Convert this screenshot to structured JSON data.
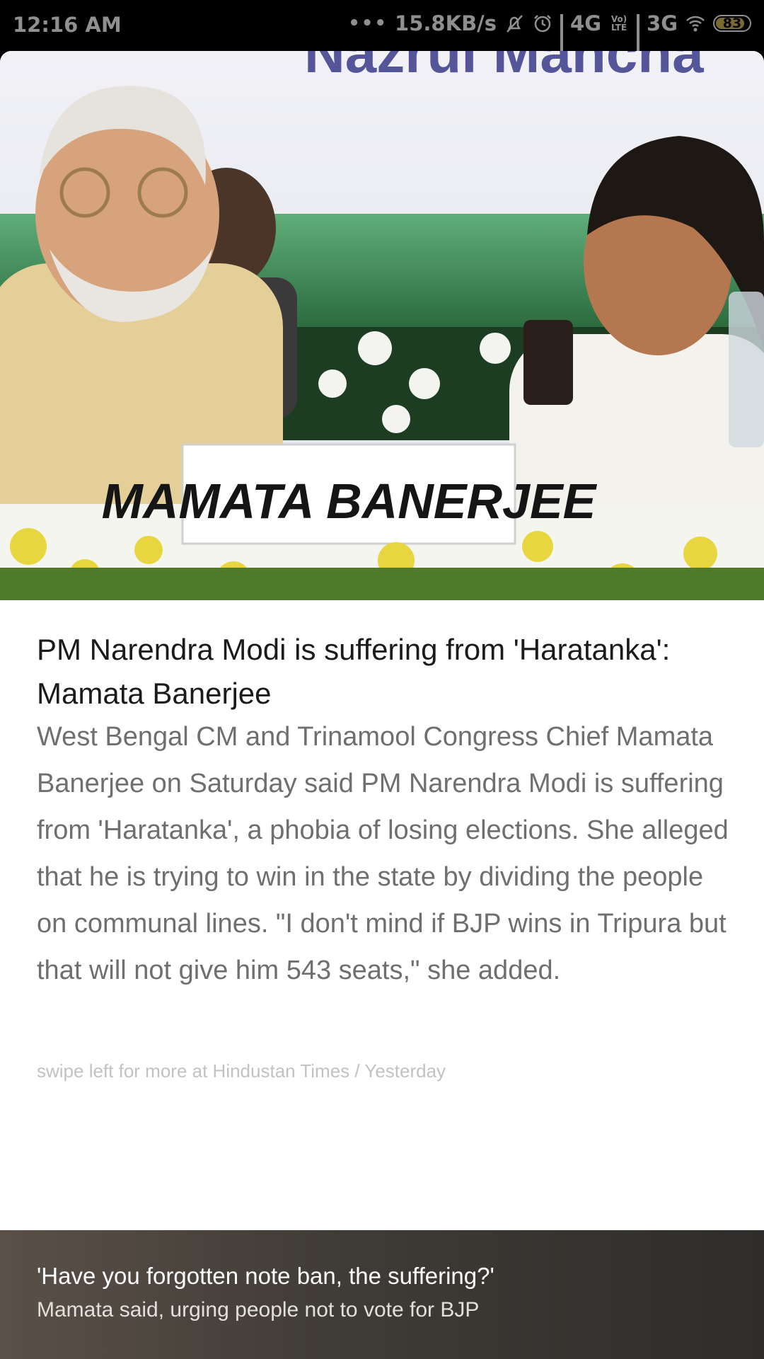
{
  "status_bar": {
    "time": "12:16 AM",
    "dots": "•••",
    "net_speed": "15.8KB/s",
    "network_1": "4G",
    "volte": "Vo) LTE",
    "network_2": "3G",
    "battery": "83"
  },
  "image": {
    "banner_text": "Nazrul Mancha",
    "nameplate": "MAMATA BANERJEE"
  },
  "article": {
    "headline": "PM Narendra Modi is suffering from 'Haratanka': Mamata Banerjee",
    "summary": "West Bengal CM and Trinamool Congress Chief Mamata Banerjee on Saturday said PM Narendra Modi is suffering from 'Haratanka', a phobia of losing elections. She alleged that he is trying to win in the state by dividing the people on communal lines. \"I don't mind if BJP wins in Tripura but that will not give him 543 seats,\" she added.",
    "source_line": "swipe left for more at Hindustan Times / Yesterday"
  },
  "footer": {
    "title": "'Have you forgotten note ban, the suffering?'",
    "subtitle": "Mamata said, urging people not to vote for BJP"
  },
  "colors": {
    "headline": "#1b1b1b",
    "summary": "#6f6f6f",
    "source": "#c2c2c2",
    "footer_bg": "#3f3b36"
  }
}
